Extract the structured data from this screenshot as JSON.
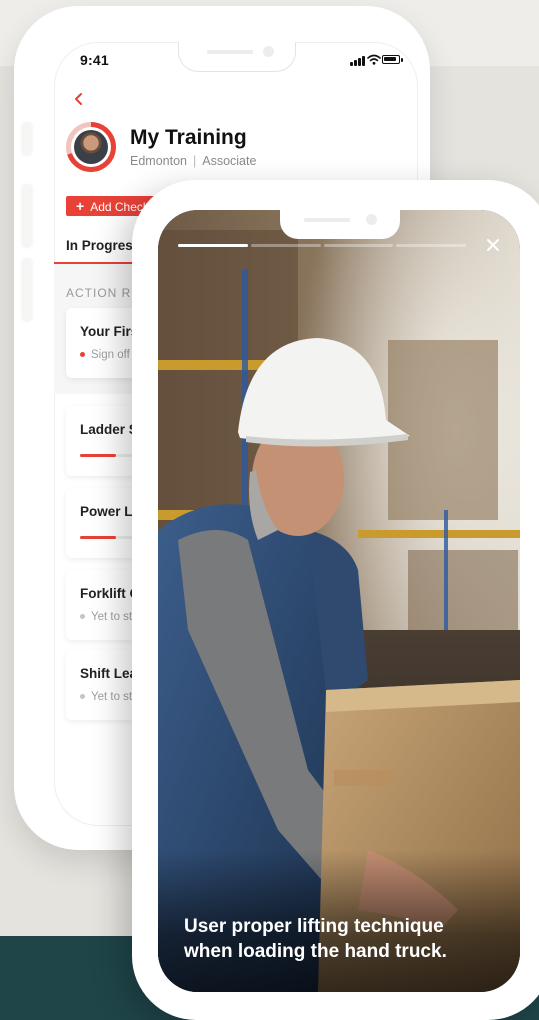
{
  "status_bar": {
    "time": "9:41"
  },
  "profile": {
    "name": "My Training",
    "location": "Edmonton",
    "separator": "|",
    "role": "Associate"
  },
  "actions": {
    "add_label": "Add Checklist",
    "add_icon": "plus-icon"
  },
  "tabs": {
    "active": "In Progress"
  },
  "section": {
    "label": "ACTION REQUIRED"
  },
  "cards": [
    {
      "title": "Your First Day",
      "status": "Sign off required",
      "status_color": "#e84137"
    },
    {
      "title": "Ladder Safety",
      "progress": 0.3
    },
    {
      "title": "Power Lifting",
      "progress": 0.3
    },
    {
      "title": "Forklift Operation",
      "status": "Yet to start",
      "status_color": "#c4c4c4"
    },
    {
      "title": "Shift Leader",
      "status": "Yet to start",
      "status_color": "#c4c4c4"
    }
  ],
  "story": {
    "segments": [
      1,
      0,
      0,
      0
    ],
    "caption_line1": "User proper lifting technique",
    "caption_line2": "when loading the hand truck.",
    "close_icon": "close-icon"
  },
  "colors": {
    "accent": "#e84137",
    "dark_band": "#1f4549",
    "background": "#e5e3de"
  }
}
